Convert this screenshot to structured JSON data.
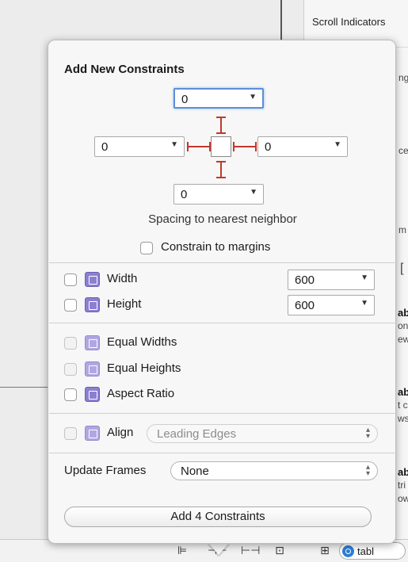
{
  "inspector": {
    "scroll_indicators": "Scroll Indicators",
    "fragments": [
      "ng",
      "ce",
      "m",
      "[",
      "ab",
      "ont",
      "ew",
      "ab",
      "t c",
      "ws",
      "ab",
      "tri",
      "ow"
    ]
  },
  "popover": {
    "title": "Add New Constraints",
    "spacing": {
      "top": "0",
      "left": "0",
      "right": "0",
      "bottom": "0"
    },
    "spacing_hint": "Spacing to nearest neighbor",
    "constrain_to_margins": "Constrain to margins",
    "width_label": "Width",
    "width_value": "600",
    "height_label": "Height",
    "height_value": "600",
    "equal_widths": "Equal Widths",
    "equal_heights": "Equal Heights",
    "aspect_ratio": "Aspect Ratio",
    "align_label": "Align",
    "align_value": "Leading Edges",
    "update_frames_label": "Update Frames",
    "update_frames_value": "None",
    "add_button": "Add 4 Constraints"
  },
  "bottom_bar": {
    "search_value": "tabl"
  }
}
